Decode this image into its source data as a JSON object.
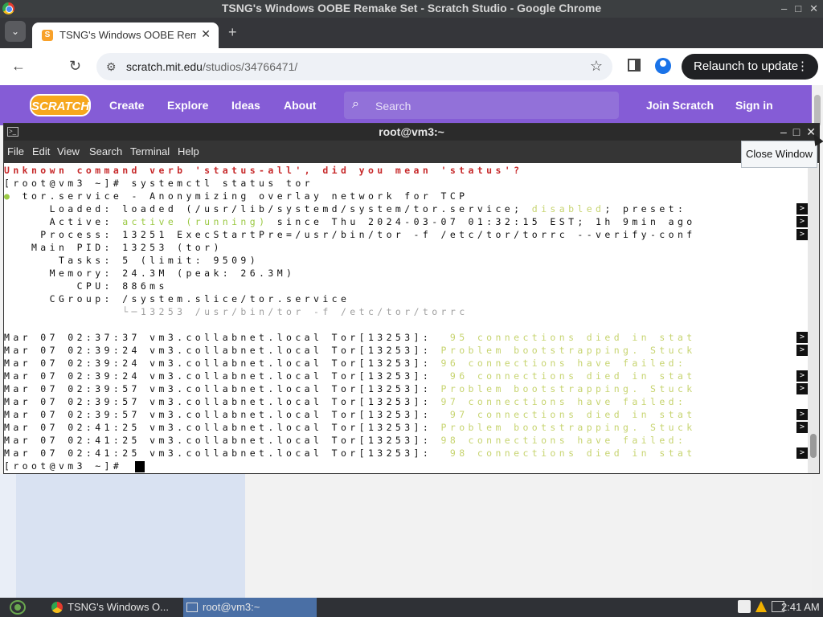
{
  "chrome": {
    "window_title": "TSNG's Windows OOBE Remake Set - Scratch Studio - Google Chrome",
    "minimize": "–",
    "maximize": "□",
    "close": "✕",
    "tab_title": "TSNG's Windows OOBE Remake Set - Scratch Studio",
    "tab_close": "✕",
    "new_tab": "+",
    "url_host": "scratch.mit.edu",
    "url_path": "/studios/34766471/",
    "relaunch_label": "Relaunch to update",
    "icons": [
      "back-icon",
      "reload-icon",
      "tune-icon",
      "star-icon",
      "side-panel-icon",
      "profile-icon",
      "menu-dots-icon"
    ]
  },
  "scratch": {
    "logo": "SCRATCH",
    "nav": [
      "Create",
      "Explore",
      "Ideas",
      "About"
    ],
    "search_placeholder": "Search",
    "join": "Join Scratch",
    "signin": "Sign in"
  },
  "terminal": {
    "title": "root@vm3:~",
    "menu": [
      "File",
      "Edit",
      "View",
      "Search",
      "Terminal",
      "Help"
    ],
    "lines": [
      {
        "text": "Unknown command verb 'status-all', did you mean 'status'?",
        "cls": "red"
      },
      {
        "text": "[root@vm3 ~]# systemctl status tor",
        "cls": ""
      },
      {
        "text": "● tor.service - Anonymizing overlay network for TCP",
        "cls": ""
      },
      {
        "text": "     Loaded: loaded (/usr/lib/systemd/system/tor.service; disabled; preset: ",
        "cls": ""
      },
      {
        "text": "     Active: active (running) since Thu 2024-03-07 01:32:15 EST; 1h 9min ago",
        "cls": ""
      },
      {
        "text": "    Process: 13251 ExecStartPre=/usr/bin/tor -f /etc/tor/torrc --verify-conf",
        "cls": ""
      },
      {
        "text": "   Main PID: 13253 (tor)",
        "cls": ""
      },
      {
        "text": "      Tasks: 5 (limit: 9509)",
        "cls": ""
      },
      {
        "text": "     Memory: 24.3M (peak: 26.3M)",
        "cls": ""
      },
      {
        "text": "        CPU: 886ms",
        "cls": ""
      },
      {
        "text": "     CGroup: /system.slice/tor.service",
        "cls": ""
      },
      {
        "text": "             └─13253 /usr/bin/tor -f /etc/tor/torrc",
        "cls": "gray"
      },
      {
        "text": "",
        "cls": ""
      },
      {
        "text": "Mar 07 02:37:37 vm3.collabnet.local Tor[13253]:  95 connections died in stat",
        "cls": "log"
      },
      {
        "text": "Mar 07 02:39:24 vm3.collabnet.local Tor[13253]: Problem bootstrapping. Stuck",
        "cls": "log"
      },
      {
        "text": "Mar 07 02:39:24 vm3.collabnet.local Tor[13253]: 96 connections have failed:",
        "cls": "log"
      },
      {
        "text": "Mar 07 02:39:24 vm3.collabnet.local Tor[13253]:  96 connections died in stat",
        "cls": "log"
      },
      {
        "text": "Mar 07 02:39:57 vm3.collabnet.local Tor[13253]: Problem bootstrapping. Stuck",
        "cls": "log"
      },
      {
        "text": "Mar 07 02:39:57 vm3.collabnet.local Tor[13253]: 97 connections have failed:",
        "cls": "log"
      },
      {
        "text": "Mar 07 02:39:57 vm3.collabnet.local Tor[13253]:  97 connections died in stat",
        "cls": "log"
      },
      {
        "text": "Mar 07 02:41:25 vm3.collabnet.local Tor[13253]: Problem bootstrapping. Stuck",
        "cls": "log"
      },
      {
        "text": "Mar 07 02:41:25 vm3.collabnet.local Tor[13253]: 98 connections have failed:",
        "cls": "log"
      },
      {
        "text": "Mar 07 02:41:25 vm3.collabnet.local Tor[13253]:  98 connections died in stat",
        "cls": "log"
      },
      {
        "text": "[root@vm3 ~]# ",
        "cls": "prompt"
      }
    ],
    "trunc_marker": ">",
    "colors": {
      "error": "#c7292a",
      "active": "#9bc944",
      "log_message": "#c7d470"
    }
  },
  "tooltip": "Close Window",
  "taskbar": {
    "task1": "TSNG's Windows O...",
    "task2": "root@vm3:~",
    "clock": "2:41 AM"
  }
}
